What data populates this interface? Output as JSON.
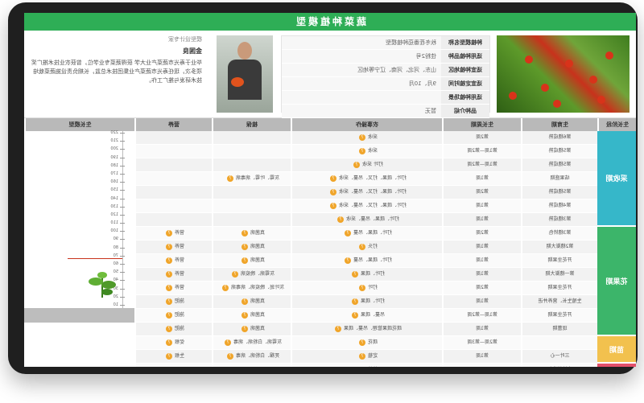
{
  "title": "蔬菜种植模型",
  "info": [
    {
      "k": "种植模型名称",
      "v": "秋冬茬番茄种植模型"
    },
    {
      "k": "适用种植品种",
      "v": "佳粉2号"
    },
    {
      "k": "适宜种植地区",
      "v": "山东、河北、河南、辽宁等地区"
    },
    {
      "k": "适宜定植时间",
      "v": "9月、10月"
    },
    {
      "k": "适用种植场景",
      "v": ""
    },
    {
      "k": "品种介绍",
      "v": "暂无"
    }
  ],
  "expert": {
    "title": "模型设计专家",
    "name": "金国良",
    "bio": "毕业于寿光市蔬菜产业大学 获得蔬菜专业学位，曾获农业技术推广奖项多次，现任寿光市蔬菜产业集团技术总监，长期负责设施蔬菜栽培技术研发与推广工作。"
  },
  "headers": [
    "生长阶段",
    "生育期",
    "生长周期",
    "农事操作",
    "植保",
    "营养",
    "生长模型"
  ],
  "stages": [
    {
      "name": "采收期",
      "rows": 7,
      "color": "#36b7c9"
    },
    {
      "name": "花果期",
      "rows": 8,
      "color": "#3cb56a"
    },
    {
      "name": "苗期",
      "rows": 2,
      "color": "#f2c14e"
    },
    {
      "name": "生产准备期",
      "rows": 2,
      "color": "#e3506a"
    }
  ],
  "rows": [
    {
      "period": "第6穗成熟",
      "cycle": "第2周",
      "op": "采收",
      "protect": "",
      "nutri": ""
    },
    {
      "period": "第5穗成熟",
      "cycle": "第1周—第2周",
      "op": "采收",
      "protect": "",
      "nutri": ""
    },
    {
      "period": "第5穗成熟",
      "cycle": "第1周—第2周",
      "op": "打叶 采收",
      "protect": "",
      "nutri": ""
    },
    {
      "period": "结果盛期",
      "cycle": "第1周",
      "op": "打叶、疏果、打叉、吊蔓、采收",
      "protect": "灰霉、叶霉、病毒病",
      "nutri": ""
    },
    {
      "period": "第5穗成熟",
      "cycle": "第2周",
      "op": "打叶、疏果、打叉、吊蔓、采收",
      "protect": "",
      "nutri": ""
    },
    {
      "period": "第4穗成熟",
      "cycle": "第1周",
      "op": "打叶、疏果、打叉、吊蔓、采收",
      "protect": "",
      "nutri": ""
    },
    {
      "period": "第3穗成熟",
      "cycle": "第1周",
      "op": "打叶、疏果、吊蔓、采收",
      "protect": "",
      "nutri": ""
    },
    {
      "period": "第3穗转色",
      "cycle": "第2周",
      "op": "打叶、疏果、吊蔓",
      "protect": "真菌病",
      "nutri": "营养"
    },
    {
      "period": "第2穗膨大期",
      "cycle": "第1周",
      "op": "打头",
      "protect": "真菌病",
      "nutri": "营养"
    },
    {
      "period": "开花坐果期",
      "cycle": "第1周",
      "op": "打叶、疏果、吊蔓",
      "protect": "真菌病",
      "nutri": "营养"
    },
    {
      "period": "第一穗膨大期",
      "cycle": "第1周",
      "op": "打叶、疏果",
      "protect": "灰霉病、晚疫病",
      "nutri": "营养"
    },
    {
      "period": "开花坐果期",
      "cycle": "第2周",
      "op": "打叶",
      "protect": "灰叶斑、晚疫病、病毒病",
      "nutri": "营养"
    },
    {
      "period": "生殖生长、营养并进",
      "cycle": "第1周",
      "op": "打叶、疏果",
      "protect": "真菌病",
      "nutri": "施肥"
    },
    {
      "period": "开花坐果期",
      "cycle": "第1周—第2周",
      "op": "吊蔓、疏果",
      "protect": "真菌病",
      "nutri": "施肥"
    },
    {
      "period": "现蕾期",
      "cycle": "第1周",
      "op": "疏花疏果管理、吊蔓、疏果",
      "protect": "真菌病",
      "nutri": "施肥"
    },
    {
      "period": "",
      "cycle": "第2周—第3周",
      "op": "疏花",
      "protect": "灰霉病、白粉病、病毒",
      "nutri": "促根"
    },
    {
      "period": "三叶一心",
      "cycle": "第1周",
      "op": "定植",
      "protect": "死棵、白粉病、病毒",
      "nutri": "生根"
    },
    {
      "period": "定植前准备",
      "cycle": "",
      "op": "整地",
      "protect": "",
      "nutri": ""
    },
    {
      "period": "生产准备期",
      "cycle": "",
      "op": "设施、施肥、整地、扣棚",
      "protect": "",
      "nutri": "底肥"
    }
  ],
  "ruler": [
    "220",
    "210",
    "200",
    "190",
    "180",
    "170",
    "160",
    "150",
    "140",
    "130",
    "120",
    "110",
    "100",
    "90",
    "80",
    "70",
    "60",
    "50",
    "40",
    "30",
    "20",
    "10"
  ]
}
